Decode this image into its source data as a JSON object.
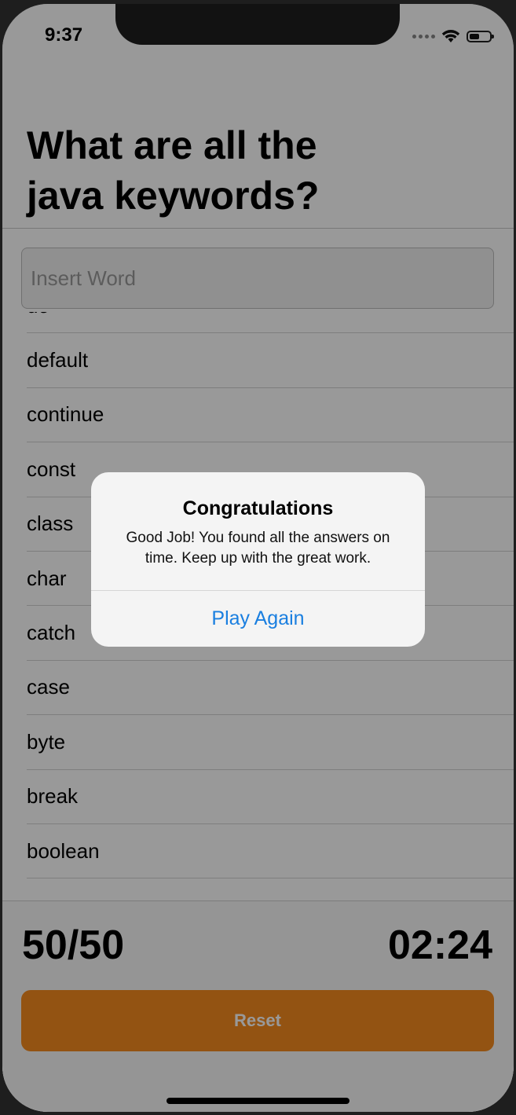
{
  "status_bar": {
    "time": "9:37",
    "battery_level": 0.5
  },
  "question": {
    "title": "What are all the java keywords?"
  },
  "input": {
    "placeholder": "Insert Word",
    "value": ""
  },
  "answers": [
    "do",
    "default",
    "continue",
    "const",
    "class",
    "char",
    "catch",
    "case",
    "byte",
    "break",
    "boolean"
  ],
  "footer": {
    "score": "50/50",
    "timer": "02:24",
    "reset_label": "Reset"
  },
  "alert": {
    "title": "Congratulations",
    "message": "Good Job! You found all the answers on time. Keep up with the great work.",
    "button_label": "Play Again"
  },
  "colors": {
    "accent_orange": "#f58a1f",
    "link_blue": "#1a7fe0"
  }
}
